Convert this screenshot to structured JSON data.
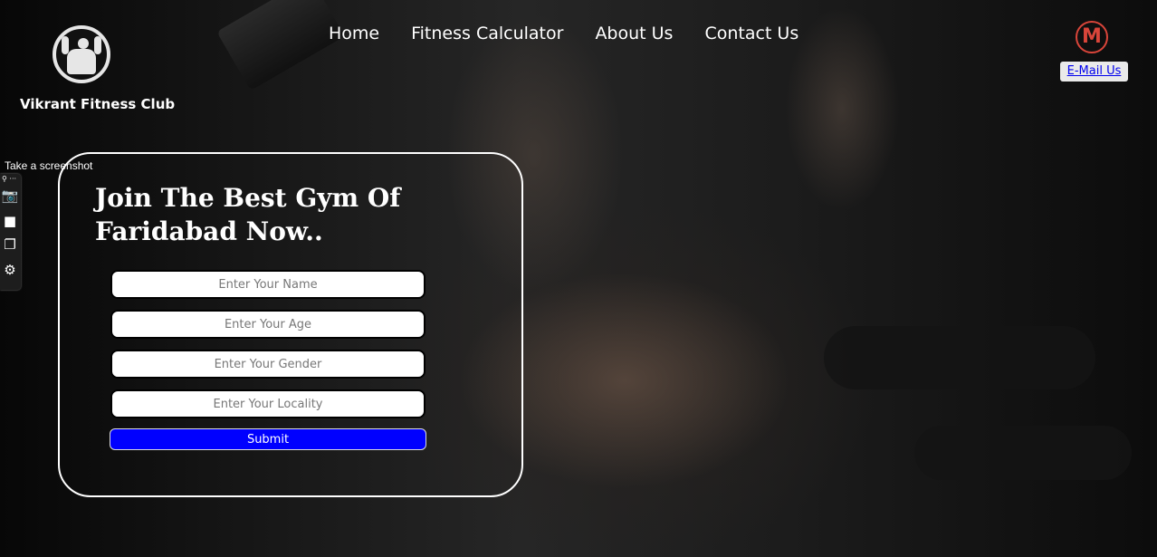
{
  "brand": {
    "name": "Vikrant Fitness Club",
    "logo_icon": "bodybuilder-icon"
  },
  "nav": {
    "items": [
      {
        "label": "Home"
      },
      {
        "label": "Fitness Calculator"
      },
      {
        "label": "About Us"
      },
      {
        "label": "Contact Us"
      }
    ]
  },
  "contact": {
    "mail_icon_glyph": "M",
    "email_label": "E-Mail Us"
  },
  "screenshot_tool": {
    "label": "Take a screenshot",
    "icons": [
      "link-icon",
      "camera-icon",
      "video-icon",
      "window-icon",
      "settings-icon"
    ]
  },
  "form": {
    "heading": "Join The Best Gym Of Faridabad Now..",
    "fields": {
      "name_placeholder": "Enter Your Name",
      "age_placeholder": "Enter Your Age",
      "gender_placeholder": "Enter Your Gender",
      "locality_placeholder": "Enter Your Locality"
    },
    "submit_label": "Submit"
  },
  "colors": {
    "submit_bg": "#0000ff",
    "mail_accent": "#d9453a",
    "link": "#0000ee"
  }
}
